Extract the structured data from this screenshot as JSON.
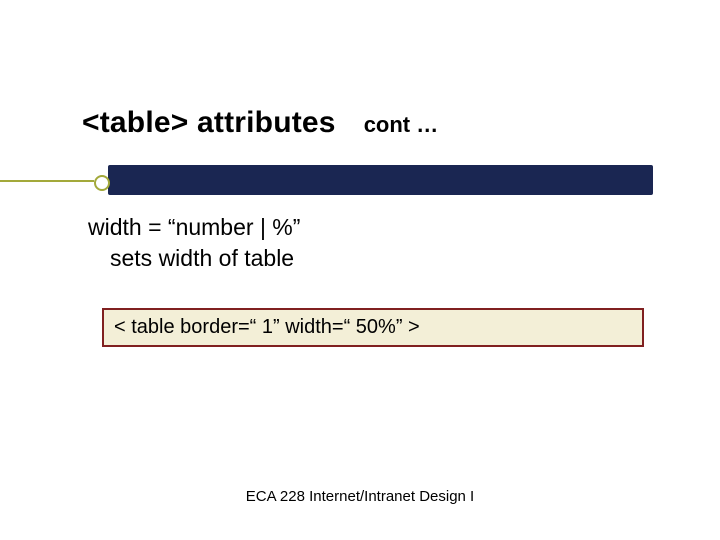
{
  "title": {
    "main": "<table> attributes",
    "cont": "cont …"
  },
  "body": {
    "line1": "width = “number | %”",
    "line2": "sets width of table"
  },
  "code": "< table border=“ 1” width=“ 50%” >",
  "footer": "ECA 228  Internet/Intranet Design I"
}
